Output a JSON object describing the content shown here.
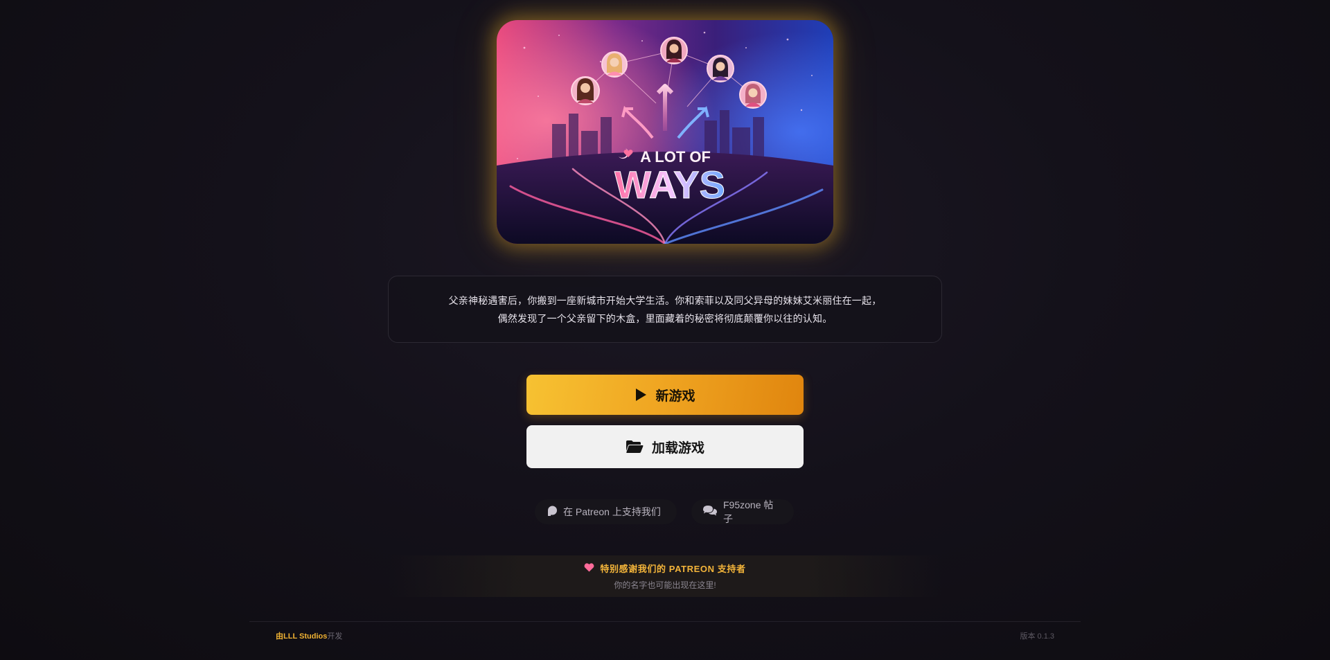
{
  "cover": {
    "logo_line1": "A LOT OF",
    "logo_line2": "WAYS",
    "icon": "game-cover-art"
  },
  "description": {
    "line1": "父亲神秘遇害后，你搬到一座新城市开始大学生活。你和索菲以及同父异母的妹妹艾米丽住在一起，",
    "line2": "偶然发现了一个父亲留下的木盒，里面藏着的秘密将彻底颠覆你以往的认知。"
  },
  "buttons": {
    "new_game": "新游戏",
    "new_game_icon": "play-icon",
    "load_game": "加载游戏",
    "load_game_icon": "folder-open-icon"
  },
  "links": {
    "patreon": "在 Patreon 上支持我们",
    "patreon_icon": "patreon-icon",
    "f95": "F95zone 帖子",
    "f95_icon": "comments-icon"
  },
  "thanks": {
    "title": "特别感谢我们的 PATREON 支持者",
    "subtitle": "你的名字也可能出现在这里!",
    "icon": "heart-icon"
  },
  "footer": {
    "developer_brand": "由LLL Studios",
    "developer_suffix": "开发",
    "version": "版本 0.1.3"
  },
  "colors": {
    "accent": "#f0b233",
    "new_game_start": "#f7c232",
    "new_game_end": "#e0850e",
    "load_game_bg": "#f1f1f1",
    "heart": "#ff6b9a"
  }
}
